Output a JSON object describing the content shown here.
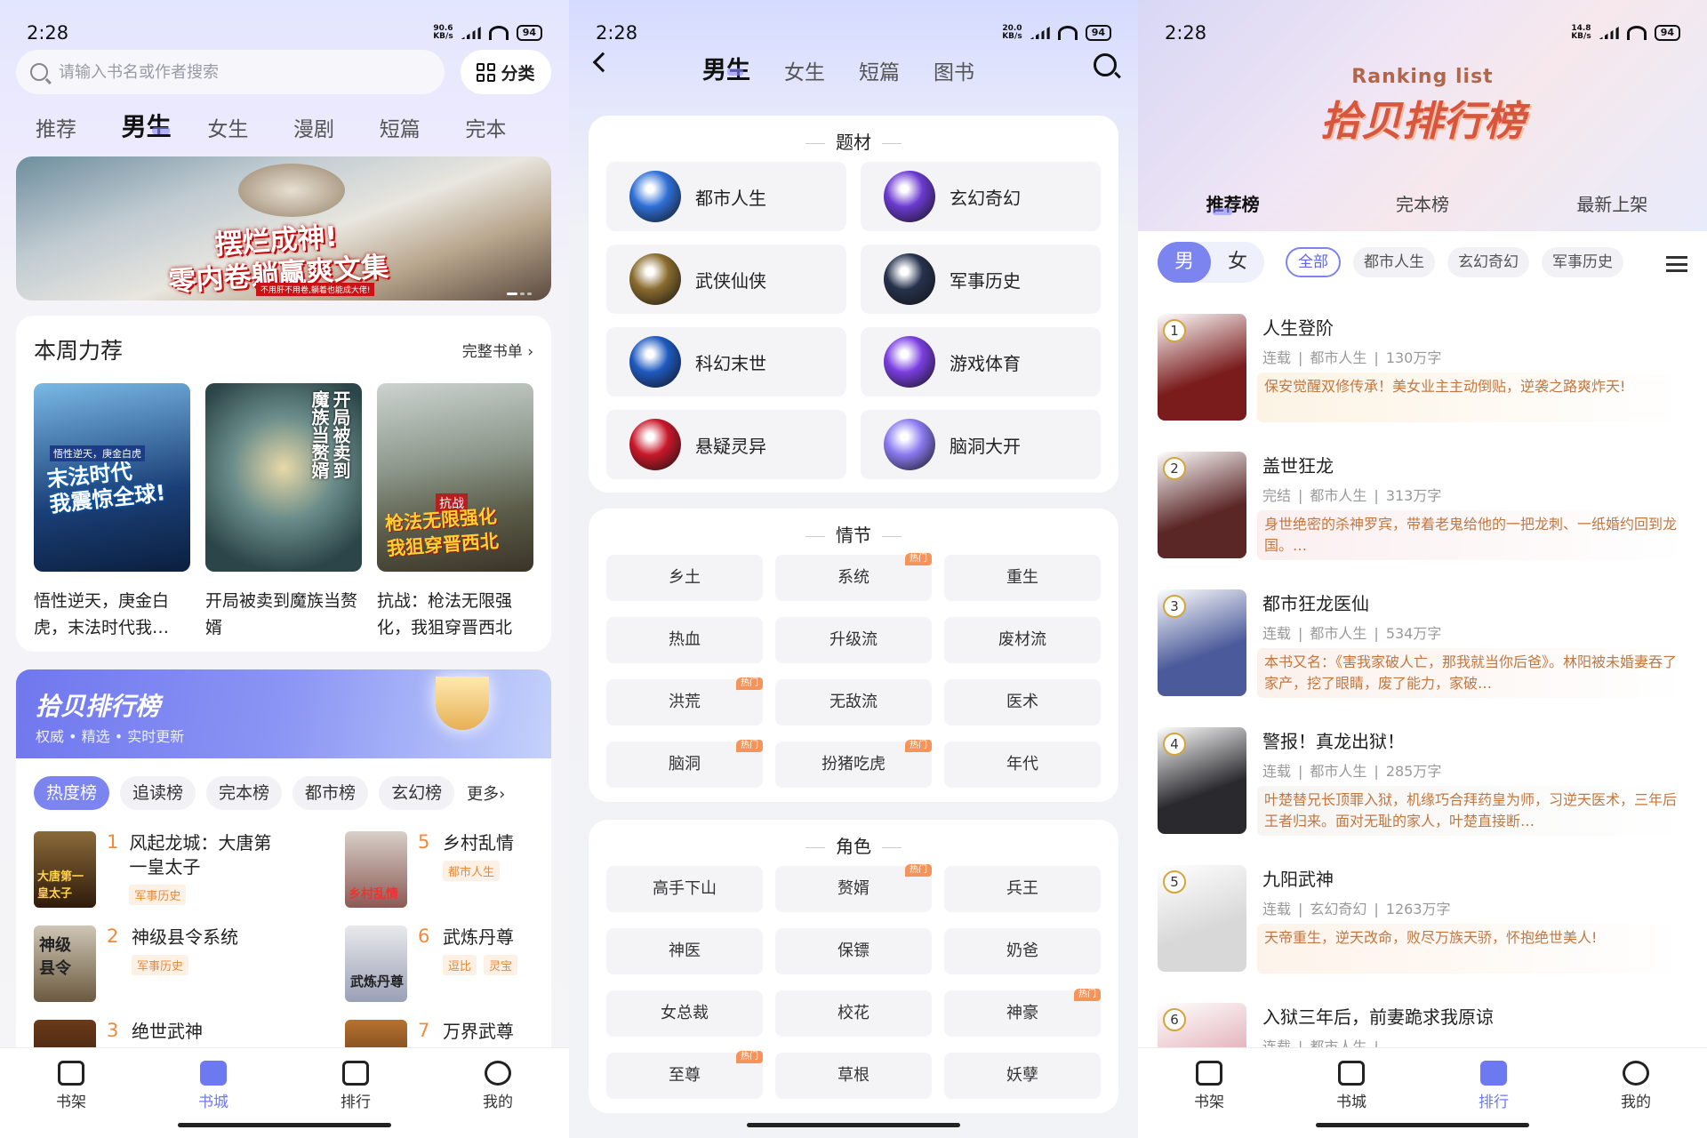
{
  "status": {
    "time": "2:28",
    "battery": "94",
    "speeds": [
      "90.6\nKB/s",
      "20.0\nKB/s",
      "14.8\nKB/s"
    ]
  },
  "panel1": {
    "search_placeholder": "请输入书名或作者搜索",
    "category_button": "分类",
    "tabs": [
      "推荐",
      "男生",
      "女生",
      "漫剧",
      "短篇",
      "完本"
    ],
    "banner": {
      "title_line1": "摆烂成神!",
      "title_line2": "零内卷躺赢爽文集",
      "subtitle": "不用肝不用卷,躺着也能成大佬!"
    },
    "weekly": {
      "title": "本周力荐",
      "more": "完整书单 ›",
      "books": [
        {
          "name": "悟性逆天，庚金白虎，末法时代我…",
          "cover_text": "末法时代\n我震惊全球!",
          "cover_top": "悟性逆天，庚金白虎"
        },
        {
          "name": "开局被卖到魔族当赘婿",
          "cover_text": "开局被卖到\n魔族当赘婿"
        },
        {
          "name": "抗战：枪法无限强化，我狙穿晋西北",
          "cover_text": "枪法无限强化\n我狙穿晋西北",
          "cover_top": "抗战"
        }
      ]
    },
    "ranking": {
      "title": "拾贝排行榜",
      "subtitle": "权威 • 精选 • 实时更新",
      "chips": [
        "热度榜",
        "追读榜",
        "完本榜",
        "都市榜",
        "玄幻榜"
      ],
      "more": "更多›",
      "items": [
        {
          "num": "1",
          "name": "风起龙城：大唐第一皇太子",
          "tags": [
            "军事历史"
          ],
          "cover_text": "大唐第一\n皇太子"
        },
        {
          "num": "5",
          "name": "乡村乱情",
          "tags": [
            "都市人生"
          ],
          "cover_text": "乡村乱情"
        },
        {
          "num": "2",
          "name": "神级县令系统",
          "tags": [
            "军事历史"
          ],
          "cover_text": "神级\n县令"
        },
        {
          "num": "6",
          "name": "武炼丹尊",
          "tags": [
            "逗比",
            "灵宝"
          ],
          "cover_text": "武炼丹尊"
        },
        {
          "num": "3",
          "name": "绝世武神",
          "tags": []
        },
        {
          "num": "7",
          "name": "万界武尊",
          "tags": []
        }
      ]
    }
  },
  "nav": [
    {
      "label": "书架",
      "icon": "bookshelf-icon"
    },
    {
      "label": "书城",
      "icon": "bookstore-icon"
    },
    {
      "label": "排行",
      "icon": "ranking-icon"
    },
    {
      "label": "我的",
      "icon": "profile-icon"
    }
  ],
  "panel2": {
    "tabs": [
      "男生",
      "女生",
      "短篇",
      "图书"
    ],
    "hot_label": "热门",
    "genres": {
      "title": "题材",
      "items": [
        {
          "label": "都市人生",
          "color": "#2f6fd6"
        },
        {
          "label": "玄幻奇幻",
          "color": "#6b3ad0"
        },
        {
          "label": "武侠仙侠",
          "color": "#8a6b2e"
        },
        {
          "label": "军事历史",
          "color": "#26324d"
        },
        {
          "label": "科幻末世",
          "color": "#1e5ac0"
        },
        {
          "label": "游戏体育",
          "color": "#7a3ee0"
        },
        {
          "label": "悬疑灵异",
          "color": "#c8182a"
        },
        {
          "label": "脑洞大开",
          "color": "#8a7af0"
        }
      ]
    },
    "plots": {
      "title": "情节",
      "items": [
        {
          "label": "乡土",
          "hot": false
        },
        {
          "label": "系统",
          "hot": true
        },
        {
          "label": "重生",
          "hot": false
        },
        {
          "label": "热血",
          "hot": false
        },
        {
          "label": "升级流",
          "hot": false
        },
        {
          "label": "废材流",
          "hot": false
        },
        {
          "label": "洪荒",
          "hot": true
        },
        {
          "label": "无敌流",
          "hot": false
        },
        {
          "label": "医术",
          "hot": false
        },
        {
          "label": "脑洞",
          "hot": true
        },
        {
          "label": "扮猪吃虎",
          "hot": true
        },
        {
          "label": "年代",
          "hot": false
        }
      ]
    },
    "roles": {
      "title": "角色",
      "items": [
        {
          "label": "高手下山",
          "hot": false
        },
        {
          "label": "赘婿",
          "hot": true
        },
        {
          "label": "兵王",
          "hot": false
        },
        {
          "label": "神医",
          "hot": false
        },
        {
          "label": "保镖",
          "hot": false
        },
        {
          "label": "奶爸",
          "hot": false
        },
        {
          "label": "女总裁",
          "hot": false
        },
        {
          "label": "校花",
          "hot": false
        },
        {
          "label": "神豪",
          "hot": true
        },
        {
          "label": "至尊",
          "hot": true
        },
        {
          "label": "草根",
          "hot": false
        },
        {
          "label": "妖孽",
          "hot": false
        }
      ]
    }
  },
  "panel3": {
    "header_en": "Ranking list",
    "header_cn": "拾贝排行榜",
    "tabs": [
      "推荐榜",
      "完本榜",
      "最新上架"
    ],
    "gender": [
      "男",
      "女"
    ],
    "filters": [
      "全部",
      "都市人生",
      "玄幻奇幻",
      "军事历史"
    ],
    "books": [
      {
        "rank": "1",
        "title": "人生登阶",
        "status": "连载",
        "genre": "都市人生",
        "words": "130万字",
        "desc": "保安觉醒双修传承！美女业主主动倒贴，逆袭之路爽炸天!",
        "bg": "#fcf3e4",
        "cover": "#7a1c1c"
      },
      {
        "rank": "2",
        "title": "盖世狂龙",
        "status": "完结",
        "genre": "都市人生",
        "words": "313万字",
        "desc": "身世绝密的杀神罗宾，带着老鬼给他的一把龙刺、一纸婚约回到龙国。…",
        "bg": "#fbeff0",
        "cover": "#5b2626"
      },
      {
        "rank": "3",
        "title": "都市狂龙医仙",
        "status": "连载",
        "genre": "都市人生",
        "words": "534万字",
        "desc": "本书又名：《害我家破人亡，那我就当你后爸》。林阳被未婚妻吞了家产，挖了眼睛，废了能力，家破…",
        "bg": "#fbf1ec",
        "cover": "#4a5a9a"
      },
      {
        "rank": "4",
        "title": "警报！真龙出狱！",
        "status": "连载",
        "genre": "都市人生",
        "words": "285万字",
        "desc": "叶楚替兄长顶罪入狱，机缘巧合拜药皇为师，习逆天医术，三年后王者归来。面对无耻的家人，叶楚直接断…",
        "bg": "#f6f5f3",
        "cover": "#2a2a2e"
      },
      {
        "rank": "5",
        "title": "九阳武神",
        "status": "连载",
        "genre": "玄幻奇幻",
        "words": "1263万字",
        "desc": "天帝重生，逆天改命，败尽万族天骄，怀抱绝世美人!",
        "bg": "#fdf3ea",
        "cover": "#d8d8d8"
      },
      {
        "rank": "6",
        "title": "入狱三年后，前妻跪求我原谅",
        "status": "连载",
        "genre": "都市人生",
        "words": "",
        "desc": "",
        "bg": "#ffffff",
        "cover": "#e2b0b8"
      }
    ]
  }
}
